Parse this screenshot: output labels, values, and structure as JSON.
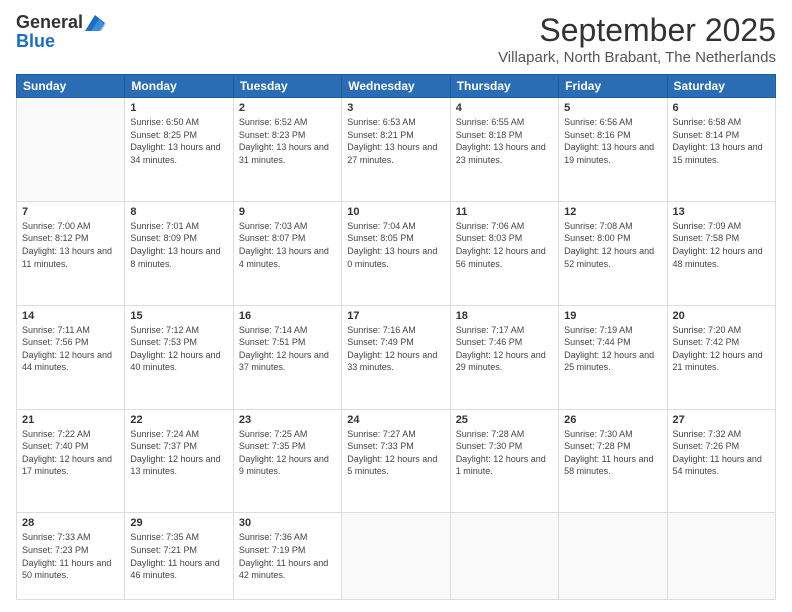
{
  "header": {
    "logo_general": "General",
    "logo_blue": "Blue",
    "month_title": "September 2025",
    "location": "Villapark, North Brabant, The Netherlands"
  },
  "days_of_week": [
    "Sunday",
    "Monday",
    "Tuesday",
    "Wednesday",
    "Thursday",
    "Friday",
    "Saturday"
  ],
  "weeks": [
    [
      {
        "day": "",
        "sunrise": "",
        "sunset": "",
        "daylight": ""
      },
      {
        "day": "1",
        "sunrise": "Sunrise: 6:50 AM",
        "sunset": "Sunset: 8:25 PM",
        "daylight": "Daylight: 13 hours and 34 minutes."
      },
      {
        "day": "2",
        "sunrise": "Sunrise: 6:52 AM",
        "sunset": "Sunset: 8:23 PM",
        "daylight": "Daylight: 13 hours and 31 minutes."
      },
      {
        "day": "3",
        "sunrise": "Sunrise: 6:53 AM",
        "sunset": "Sunset: 8:21 PM",
        "daylight": "Daylight: 13 hours and 27 minutes."
      },
      {
        "day": "4",
        "sunrise": "Sunrise: 6:55 AM",
        "sunset": "Sunset: 8:18 PM",
        "daylight": "Daylight: 13 hours and 23 minutes."
      },
      {
        "day": "5",
        "sunrise": "Sunrise: 6:56 AM",
        "sunset": "Sunset: 8:16 PM",
        "daylight": "Daylight: 13 hours and 19 minutes."
      },
      {
        "day": "6",
        "sunrise": "Sunrise: 6:58 AM",
        "sunset": "Sunset: 8:14 PM",
        "daylight": "Daylight: 13 hours and 15 minutes."
      }
    ],
    [
      {
        "day": "7",
        "sunrise": "Sunrise: 7:00 AM",
        "sunset": "Sunset: 8:12 PM",
        "daylight": "Daylight: 13 hours and 11 minutes."
      },
      {
        "day": "8",
        "sunrise": "Sunrise: 7:01 AM",
        "sunset": "Sunset: 8:09 PM",
        "daylight": "Daylight: 13 hours and 8 minutes."
      },
      {
        "day": "9",
        "sunrise": "Sunrise: 7:03 AM",
        "sunset": "Sunset: 8:07 PM",
        "daylight": "Daylight: 13 hours and 4 minutes."
      },
      {
        "day": "10",
        "sunrise": "Sunrise: 7:04 AM",
        "sunset": "Sunset: 8:05 PM",
        "daylight": "Daylight: 13 hours and 0 minutes."
      },
      {
        "day": "11",
        "sunrise": "Sunrise: 7:06 AM",
        "sunset": "Sunset: 8:03 PM",
        "daylight": "Daylight: 12 hours and 56 minutes."
      },
      {
        "day": "12",
        "sunrise": "Sunrise: 7:08 AM",
        "sunset": "Sunset: 8:00 PM",
        "daylight": "Daylight: 12 hours and 52 minutes."
      },
      {
        "day": "13",
        "sunrise": "Sunrise: 7:09 AM",
        "sunset": "Sunset: 7:58 PM",
        "daylight": "Daylight: 12 hours and 48 minutes."
      }
    ],
    [
      {
        "day": "14",
        "sunrise": "Sunrise: 7:11 AM",
        "sunset": "Sunset: 7:56 PM",
        "daylight": "Daylight: 12 hours and 44 minutes."
      },
      {
        "day": "15",
        "sunrise": "Sunrise: 7:12 AM",
        "sunset": "Sunset: 7:53 PM",
        "daylight": "Daylight: 12 hours and 40 minutes."
      },
      {
        "day": "16",
        "sunrise": "Sunrise: 7:14 AM",
        "sunset": "Sunset: 7:51 PM",
        "daylight": "Daylight: 12 hours and 37 minutes."
      },
      {
        "day": "17",
        "sunrise": "Sunrise: 7:16 AM",
        "sunset": "Sunset: 7:49 PM",
        "daylight": "Daylight: 12 hours and 33 minutes."
      },
      {
        "day": "18",
        "sunrise": "Sunrise: 7:17 AM",
        "sunset": "Sunset: 7:46 PM",
        "daylight": "Daylight: 12 hours and 29 minutes."
      },
      {
        "day": "19",
        "sunrise": "Sunrise: 7:19 AM",
        "sunset": "Sunset: 7:44 PM",
        "daylight": "Daylight: 12 hours and 25 minutes."
      },
      {
        "day": "20",
        "sunrise": "Sunrise: 7:20 AM",
        "sunset": "Sunset: 7:42 PM",
        "daylight": "Daylight: 12 hours and 21 minutes."
      }
    ],
    [
      {
        "day": "21",
        "sunrise": "Sunrise: 7:22 AM",
        "sunset": "Sunset: 7:40 PM",
        "daylight": "Daylight: 12 hours and 17 minutes."
      },
      {
        "day": "22",
        "sunrise": "Sunrise: 7:24 AM",
        "sunset": "Sunset: 7:37 PM",
        "daylight": "Daylight: 12 hours and 13 minutes."
      },
      {
        "day": "23",
        "sunrise": "Sunrise: 7:25 AM",
        "sunset": "Sunset: 7:35 PM",
        "daylight": "Daylight: 12 hours and 9 minutes."
      },
      {
        "day": "24",
        "sunrise": "Sunrise: 7:27 AM",
        "sunset": "Sunset: 7:33 PM",
        "daylight": "Daylight: 12 hours and 5 minutes."
      },
      {
        "day": "25",
        "sunrise": "Sunrise: 7:28 AM",
        "sunset": "Sunset: 7:30 PM",
        "daylight": "Daylight: 12 hours and 1 minute."
      },
      {
        "day": "26",
        "sunrise": "Sunrise: 7:30 AM",
        "sunset": "Sunset: 7:28 PM",
        "daylight": "Daylight: 11 hours and 58 minutes."
      },
      {
        "day": "27",
        "sunrise": "Sunrise: 7:32 AM",
        "sunset": "Sunset: 7:26 PM",
        "daylight": "Daylight: 11 hours and 54 minutes."
      }
    ],
    [
      {
        "day": "28",
        "sunrise": "Sunrise: 7:33 AM",
        "sunset": "Sunset: 7:23 PM",
        "daylight": "Daylight: 11 hours and 50 minutes."
      },
      {
        "day": "29",
        "sunrise": "Sunrise: 7:35 AM",
        "sunset": "Sunset: 7:21 PM",
        "daylight": "Daylight: 11 hours and 46 minutes."
      },
      {
        "day": "30",
        "sunrise": "Sunrise: 7:36 AM",
        "sunset": "Sunset: 7:19 PM",
        "daylight": "Daylight: 11 hours and 42 minutes."
      },
      {
        "day": "",
        "sunrise": "",
        "sunset": "",
        "daylight": ""
      },
      {
        "day": "",
        "sunrise": "",
        "sunset": "",
        "daylight": ""
      },
      {
        "day": "",
        "sunrise": "",
        "sunset": "",
        "daylight": ""
      },
      {
        "day": "",
        "sunrise": "",
        "sunset": "",
        "daylight": ""
      }
    ]
  ]
}
